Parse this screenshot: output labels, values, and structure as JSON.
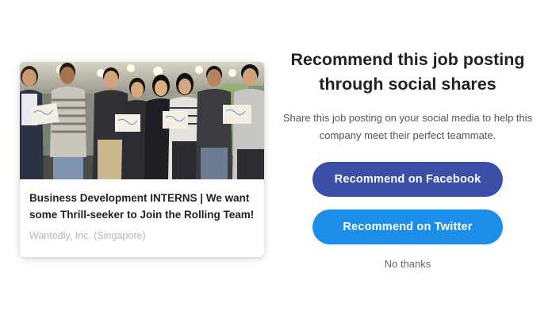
{
  "job_card": {
    "title": "Business Development INTERNS | We want some Thrill-seeker to Join the Rolling Team!",
    "company": "Wantedly, Inc. (Singapore)"
  },
  "panel": {
    "heading": "Recommend this job posting through social shares",
    "description": "Share this job posting on your social media to help this company meet their perfect teammate.",
    "facebook_button": "Recommend on Facebook",
    "twitter_button": "Recommend on Twitter",
    "dismiss_link": "No thanks"
  },
  "colors": {
    "facebook": "#3b4fa8",
    "twitter": "#1c8ee8",
    "muted_text": "#b5b5b5"
  }
}
